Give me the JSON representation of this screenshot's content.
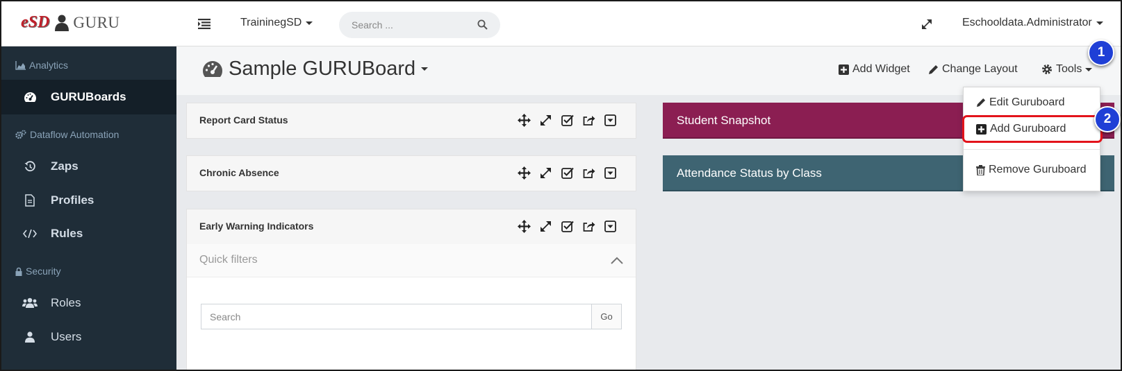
{
  "header": {
    "logo_esd": "eSD",
    "logo_guru": "GURU",
    "district": "TraininegSD",
    "search_placeholder": "Search ...",
    "user": "Eschooldata.Administrator"
  },
  "sidebar": {
    "sections": [
      {
        "label": "Analytics",
        "icon": "chart-area-icon"
      },
      {
        "label": "Dataflow Automation",
        "icon": "cogs-icon"
      },
      {
        "label": "Security",
        "icon": "lock-icon"
      }
    ],
    "items": [
      {
        "label": "GURUBoards",
        "icon": "dashboard-icon",
        "active": true
      },
      {
        "label": "Zaps",
        "icon": "history-icon"
      },
      {
        "label": "Profiles",
        "icon": "file-icon"
      },
      {
        "label": "Rules",
        "icon": "code-icon"
      },
      {
        "label": "Roles",
        "icon": "users-icon"
      },
      {
        "label": "Users",
        "icon": "user-icon"
      }
    ]
  },
  "board": {
    "title": "Sample GURUBoard",
    "add_widget": "Add Widget",
    "change_layout": "Change Layout",
    "tools": "Tools"
  },
  "widgets": [
    {
      "title": "Report Card Status"
    },
    {
      "title": "Chronic Absence"
    },
    {
      "title": "Early Warning Indicators"
    }
  ],
  "quick_filters": {
    "label": "Quick filters",
    "search_placeholder": "Search",
    "go": "Go"
  },
  "panels": [
    {
      "title": "Student Snapshot",
      "color": "#8b1e52"
    },
    {
      "title": "Attendance Status by Class",
      "color": "#3e6472"
    }
  ],
  "tools_menu": {
    "items": [
      "Edit Guruboard",
      "Add Guruboard",
      "Remove Guruboard"
    ]
  },
  "callouts": [
    "1",
    "2"
  ],
  "colors": {
    "sidebar": "#1f2d38",
    "highlight": "#e3131b",
    "badge": "#1f3fd6"
  }
}
